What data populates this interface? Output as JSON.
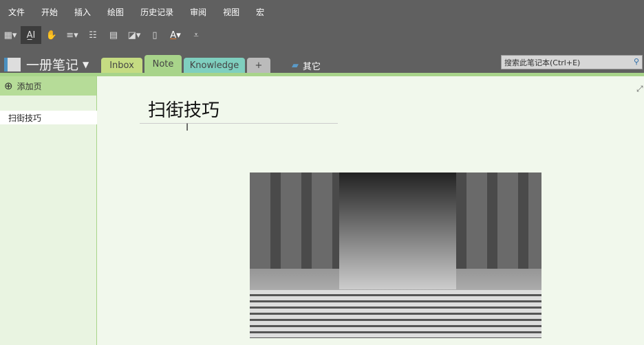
{
  "menu": [
    "文件",
    "开始",
    "插入",
    "绘图",
    "历史记录",
    "审阅",
    "视图",
    "宏"
  ],
  "notebook": {
    "name": "一册笔记"
  },
  "tabs": [
    {
      "label": "Inbox",
      "color": "#c5dc82"
    },
    {
      "label": "Note",
      "color": "#a8d48a"
    },
    {
      "label": "Knowledge",
      "color": "#7fcfbf"
    },
    {
      "label": "+",
      "color": "#bbbbbb"
    }
  ],
  "other": "其它",
  "search": {
    "placeholder": "搜索此笔记本(Ctrl+E)"
  },
  "sidebar": {
    "add_page": "添加页",
    "pages": [
      "扫街技巧"
    ]
  },
  "page": {
    "title": "扫街技巧"
  }
}
